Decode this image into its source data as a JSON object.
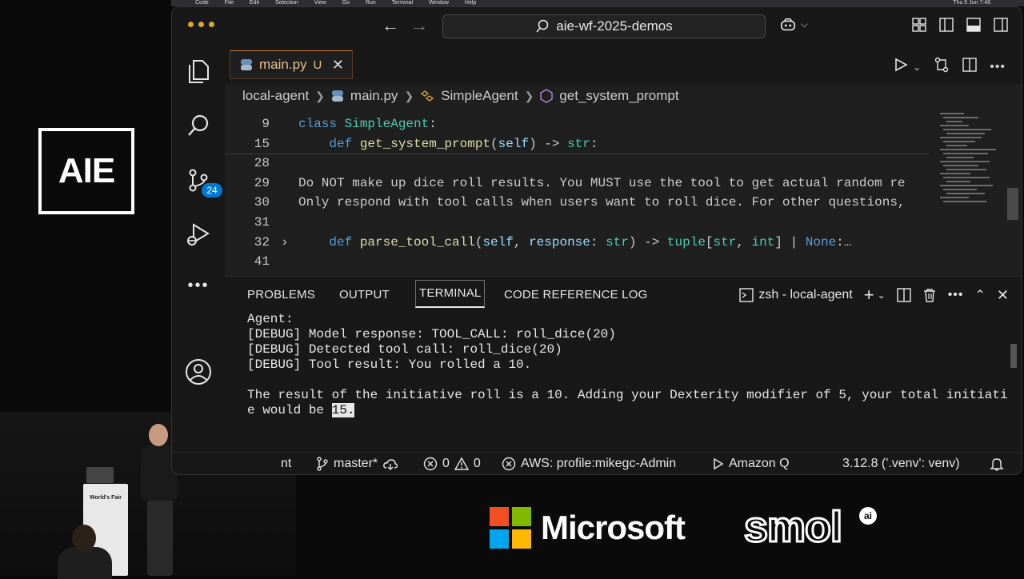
{
  "stage": {
    "logo": "AIE",
    "podium_label": "World's Fair"
  },
  "sponsors": {
    "microsoft": "Microsoft",
    "smol": "smol",
    "smol_badge": "ai"
  },
  "menubar": {
    "items": [
      "Code",
      "File",
      "Edit",
      "Selection",
      "View",
      "Go",
      "Run",
      "Terminal",
      "Window",
      "Help"
    ],
    "clock": "Thu 5 Jun 7:48"
  },
  "window": {
    "search_text": "aie-wf-2025-demos",
    "tab": {
      "label": "main.py",
      "status": "U"
    },
    "breadcrumb": [
      "local-agent",
      "main.py",
      "SimpleAgent",
      "get_system_prompt"
    ],
    "activity_badge": "24",
    "code_lines": [
      {
        "num": "9",
        "parts": [
          [
            "kw",
            "class "
          ],
          [
            "cls",
            "SimpleAgent"
          ],
          [
            "txt",
            ":"
          ]
        ]
      },
      {
        "num": "15",
        "parts": [
          [
            "txt",
            "    "
          ],
          [
            "kw",
            "def "
          ],
          [
            "fn",
            "get_system_prompt"
          ],
          [
            "txt",
            "("
          ],
          [
            "prm",
            "self"
          ],
          [
            "txt",
            ") -> "
          ],
          [
            "cls",
            "str"
          ],
          [
            "txt",
            ":"
          ]
        ]
      },
      {
        "num": "28",
        "parts": []
      },
      {
        "num": "29",
        "parts": [
          [
            "txt",
            "Do NOT make up dice roll results. You MUST use the tool to get actual random re"
          ]
        ]
      },
      {
        "num": "30",
        "parts": [
          [
            "txt",
            "Only respond with tool calls when users want to roll dice. For other questions,"
          ]
        ]
      },
      {
        "num": "31",
        "parts": []
      },
      {
        "num": "32",
        "parts": [
          [
            "txt",
            "    "
          ],
          [
            "kw",
            "def "
          ],
          [
            "fn",
            "parse_tool_call"
          ],
          [
            "txt",
            "("
          ],
          [
            "prm",
            "self"
          ],
          [
            "txt",
            ", "
          ],
          [
            "prm",
            "response"
          ],
          [
            "txt",
            ": "
          ],
          [
            "cls",
            "str"
          ],
          [
            "txt",
            ") -> "
          ],
          [
            "cls",
            "tuple"
          ],
          [
            "txt",
            "["
          ],
          [
            "cls",
            "str"
          ],
          [
            "txt",
            ", "
          ],
          [
            "cls",
            "int"
          ],
          [
            "txt",
            "] | "
          ],
          [
            "kw",
            "None"
          ],
          [
            "txt",
            ":…"
          ]
        ]
      },
      {
        "num": "41",
        "parts": []
      }
    ],
    "panel_tabs": [
      "PROBLEMS",
      "OUTPUT",
      "TERMINAL",
      "CODE REFERENCE LOG"
    ],
    "terminal_name": "zsh - local-agent",
    "terminal_lines": [
      "Agent:",
      "[DEBUG] Model response: TOOL_CALL: roll_dice(20)",
      "[DEBUG] Detected tool call: roll_dice(20)",
      "[DEBUG] Tool result: You rolled a 10.",
      "",
      "The result of the initiative roll is a 10. Adding your Dexterity modifier of 5, your total initiativ"
    ],
    "terminal_last_prefix": "e would be ",
    "terminal_last_highlight": "15.",
    "status": {
      "remote": "nt",
      "branch": "master*",
      "errors": "0",
      "warnings": "0",
      "aws": "AWS: profile:mikegc-Admin",
      "amazonq": "Amazon Q",
      "python": "3.12.8 ('.venv': venv)"
    }
  },
  "colors": {
    "accent": "#0078d4",
    "keyword": "#569cd6",
    "function": "#dcdcaa",
    "class": "#4ec9b0",
    "param": "#9cdcfe",
    "tab_modified": "#e2c08d"
  }
}
